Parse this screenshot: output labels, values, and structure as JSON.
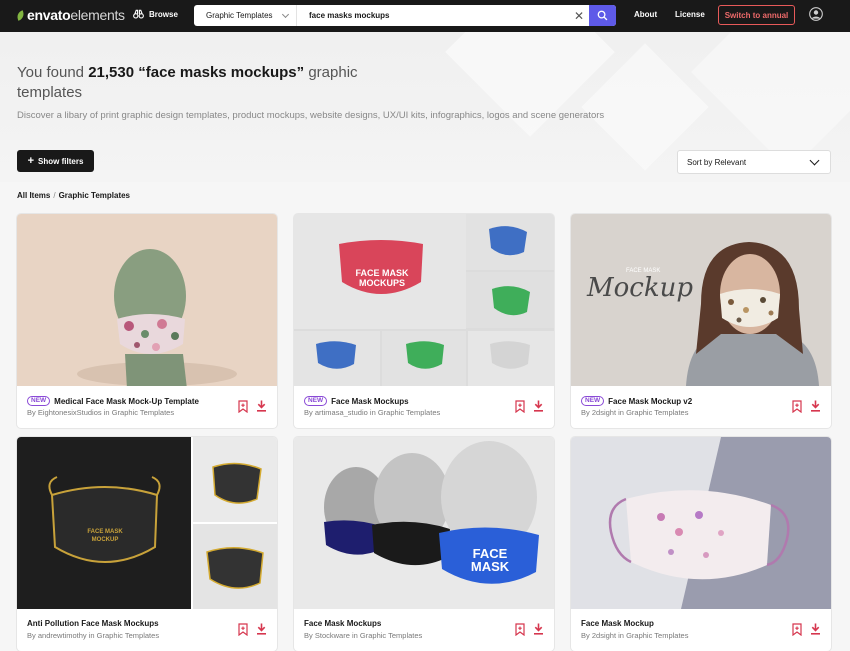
{
  "header": {
    "logo_brand": "envato",
    "logo_product": "elements",
    "browse_label": "Browse",
    "category_label": "Graphic Templates",
    "search_value": "face masks mockups",
    "nav_about": "About",
    "nav_license": "License",
    "switch_label": "Switch to annual"
  },
  "hero": {
    "title_prefix": "You found ",
    "title_count": "21,530 “face masks mockups”",
    "title_suffix": " graphic templates",
    "subtitle": "Discover a libary of print graphic design templates, product mockups, website designs, UX/UI kits, infographics, logos and scene generators"
  },
  "controls": {
    "filters_label": "Show filters",
    "sort_label": "Sort by Relevant"
  },
  "breadcrumb": {
    "root": "All Items",
    "separator": "/",
    "current": "Graphic Templates"
  },
  "cards": [
    {
      "is_new": true,
      "new_label": "NEW",
      "title": "Medical Face Mask Mock-Up Template",
      "by": "By",
      "author": "EightonesixStudios",
      "in": "in",
      "category": "Graphic Templates"
    },
    {
      "is_new": true,
      "new_label": "NEW",
      "title": "Face Mask Mockups",
      "by": "By",
      "author": "artimasa_studio",
      "in": "in",
      "category": "Graphic Templates"
    },
    {
      "is_new": true,
      "new_label": "NEW",
      "title": "Face Mask Mockup v2",
      "by": "By",
      "author": "2dsight",
      "in": "in",
      "category": "Graphic Templates"
    },
    {
      "is_new": false,
      "new_label": "",
      "title": "Anti Pollution Face Mask Mockups",
      "by": "By",
      "author": "andrewtimothy",
      "in": "in",
      "category": "Graphic Templates"
    },
    {
      "is_new": false,
      "new_label": "",
      "title": "Face Mask Mockups",
      "by": "By",
      "author": "Stockware",
      "in": "in",
      "category": "Graphic Templates"
    },
    {
      "is_new": false,
      "new_label": "",
      "title": "Face Mask Mockup",
      "by": "By",
      "author": "2dsight",
      "in": "in",
      "category": "Graphic Templates"
    }
  ],
  "thumb_text": {
    "card2_line1": "FACE MASK",
    "card2_line2": "MOCKUPS",
    "card3_script": "Mockup",
    "card3_small": "FACE MASK",
    "card4_line1": "FACE MASK",
    "card4_line2": "MOCKUP",
    "card5_line1": "FACE",
    "card5_line2": "MASK"
  },
  "colors": {
    "topbar": "#191919",
    "search_button": "#5e5ae8",
    "accent_red": "#e85a5a",
    "new_badge": "#8a4ad6",
    "action_red": "#d6364e"
  }
}
